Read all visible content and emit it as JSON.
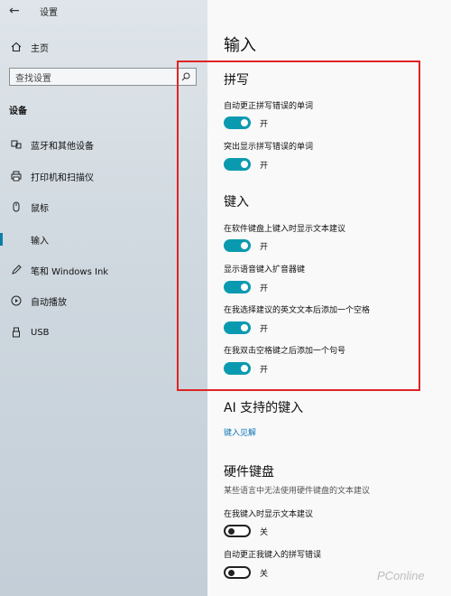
{
  "app": {
    "title": "设置",
    "back_glyph": "←"
  },
  "sidebar": {
    "home_label": "主页",
    "search_placeholder": "查找设置",
    "section_label": "设备",
    "items": [
      {
        "label": "蓝牙和其他设备",
        "icon": "bluetooth-icon"
      },
      {
        "label": "打印机和扫描仪",
        "icon": "printer-icon"
      },
      {
        "label": "鼠标",
        "icon": "mouse-icon"
      },
      {
        "label": "输入",
        "icon": "keyboard-icon",
        "active": true
      },
      {
        "label": "笔和 Windows Ink",
        "icon": "pen-icon"
      },
      {
        "label": "自动播放",
        "icon": "autoplay-icon"
      },
      {
        "label": "USB",
        "icon": "usb-icon"
      }
    ]
  },
  "main": {
    "page_title": "输入",
    "spelling": {
      "heading": "拼写",
      "options": [
        {
          "label": "自动更正拼写错误的单词",
          "state": "开",
          "on": true
        },
        {
          "label": "突出显示拼写错误的单词",
          "state": "开",
          "on": true
        }
      ]
    },
    "typing": {
      "heading": "键入",
      "options": [
        {
          "label": "在软件键盘上键入时显示文本建议",
          "state": "开",
          "on": true
        },
        {
          "label": "显示语音键入扩音器键",
          "state": "开",
          "on": true
        },
        {
          "label": "在我选择建议的英文文本后添加一个空格",
          "state": "开",
          "on": true
        },
        {
          "label": "在我双击空格键之后添加一个句号",
          "state": "开",
          "on": true
        }
      ]
    },
    "ai": {
      "heading": "AI 支持的键入",
      "link": "键入见解"
    },
    "hardware": {
      "heading": "硬件键盘",
      "description": "某些语言中无法使用硬件键盘的文本建议",
      "options": [
        {
          "label": "在我键入时显示文本建议",
          "state": "关",
          "on": false
        },
        {
          "label": "自动更正我键入的拼写错误",
          "state": "关",
          "on": false
        }
      ]
    }
  },
  "watermark": "PConline",
  "colors": {
    "accent": "#0a9ab0",
    "highlight": "#e02424",
    "link": "#0d74b5"
  }
}
